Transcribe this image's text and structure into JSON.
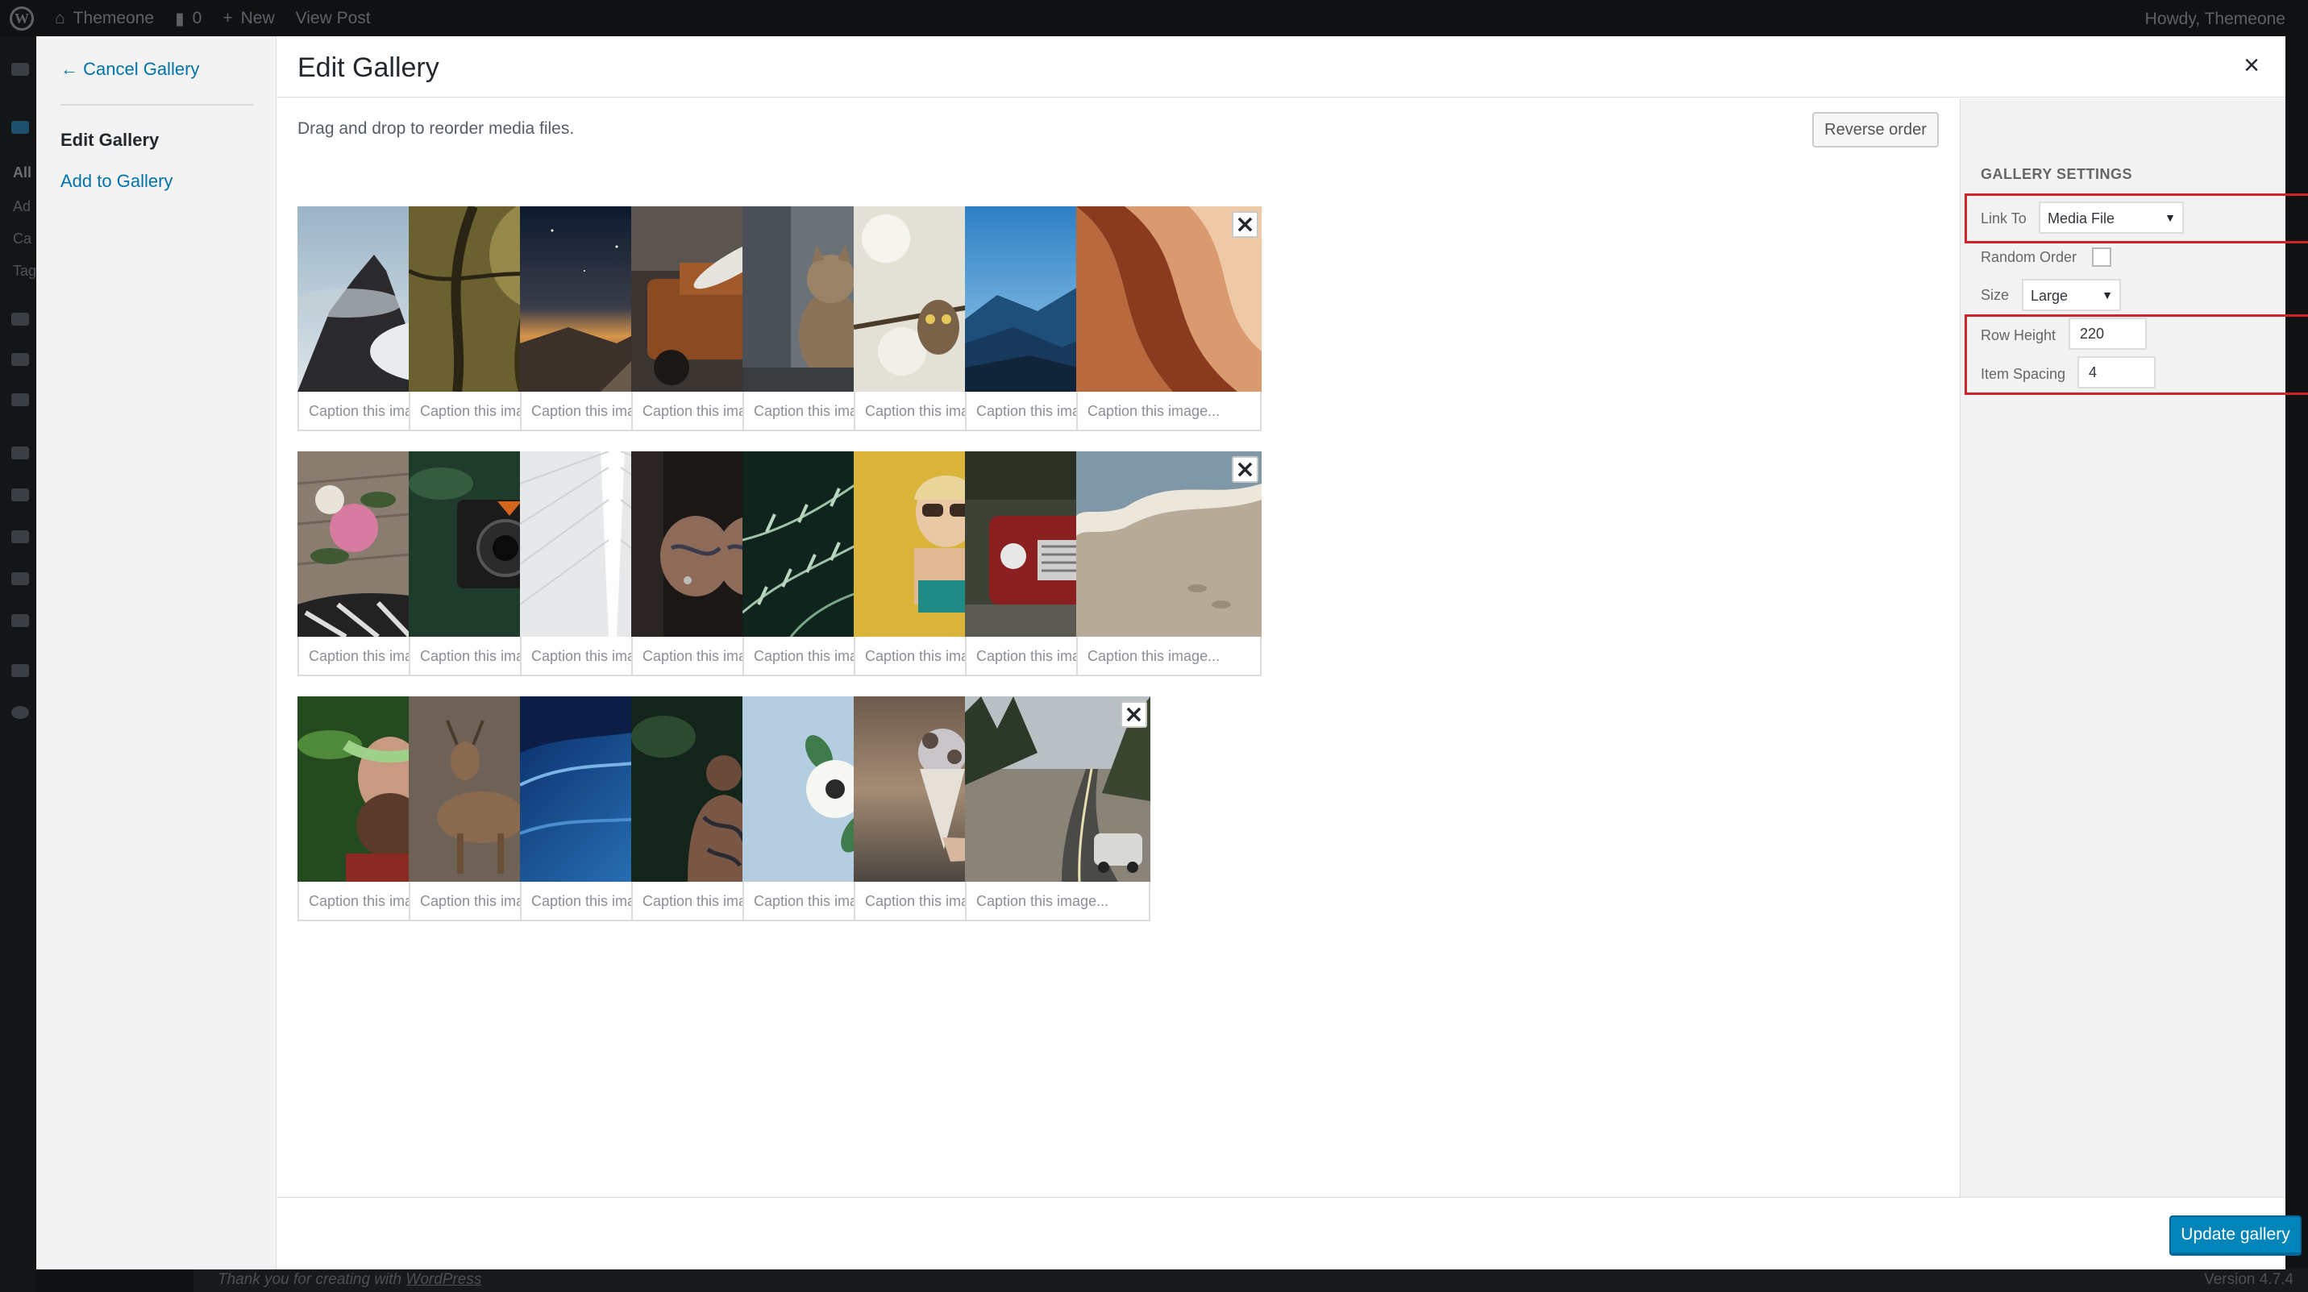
{
  "admin_bar": {
    "site_name": "Themeone",
    "comments_count": "0",
    "new_label": "New",
    "view_post_label": "View Post",
    "greeting": "Howdy, Themeone"
  },
  "admin_menu": {
    "partial_labels": [
      "All",
      "Ad",
      "Ca",
      "Tag"
    ]
  },
  "footer": {
    "thanks_prefix": "Thank you for creating with ",
    "thanks_link": "WordPress",
    "version": "Version 4.7.4"
  },
  "modal": {
    "title": "Edit Gallery",
    "close_icon": "close-icon",
    "menu": {
      "cancel_label": "← Cancel Gallery",
      "items": [
        {
          "label": "Edit Gallery",
          "current": true
        },
        {
          "label": "Add to Gallery",
          "current": false
        }
      ]
    },
    "instructions": "Drag and drop to reorder media files.",
    "reverse_label": "Reverse order",
    "caption_placeholder": "Caption this image...",
    "remove_icon": "close-x-icon",
    "images": [
      {
        "name": "mountain-peak-clouds"
      },
      {
        "name": "forest-branches"
      },
      {
        "name": "starry-night-mountains"
      },
      {
        "name": "rusty-truck-surfboard"
      },
      {
        "name": "cat-sitting"
      },
      {
        "name": "owl-in-blossoms"
      },
      {
        "name": "blue-mountain-ranges"
      },
      {
        "name": "orange-rock-texture"
      },
      {
        "name": "flowers-on-deck"
      },
      {
        "name": "vintage-camera-leaves"
      },
      {
        "name": "white-architecture"
      },
      {
        "name": "tattooed-hands-rings"
      },
      {
        "name": "fern-leaves"
      },
      {
        "name": "woman-sunglasses-yellow-wall"
      },
      {
        "name": "red-vintage-car"
      },
      {
        "name": "sandy-beach"
      },
      {
        "name": "bearded-man-leaves"
      },
      {
        "name": "deer-standing"
      },
      {
        "name": "blue-ocean-wave"
      },
      {
        "name": "tattooed-back-forest"
      },
      {
        "name": "white-flower-blue-background"
      },
      {
        "name": "ice-cream-cone-hand"
      },
      {
        "name": "van-on-forest-road"
      }
    ],
    "settings": {
      "heading": "Gallery Settings",
      "link_to_label": "Link To",
      "link_to_value": "Media File",
      "random_order_label": "Random Order",
      "random_order_checked": false,
      "size_label": "Size",
      "size_value": "Large",
      "row_height_label": "Row Height",
      "row_height_value": "220",
      "item_spacing_label": "Item Spacing",
      "item_spacing_value": "4"
    },
    "update_label": "Update gallery",
    "colors": {
      "primary_button": "#0085ba",
      "link": "#0073aa",
      "highlight_box": "#d2232a"
    }
  }
}
